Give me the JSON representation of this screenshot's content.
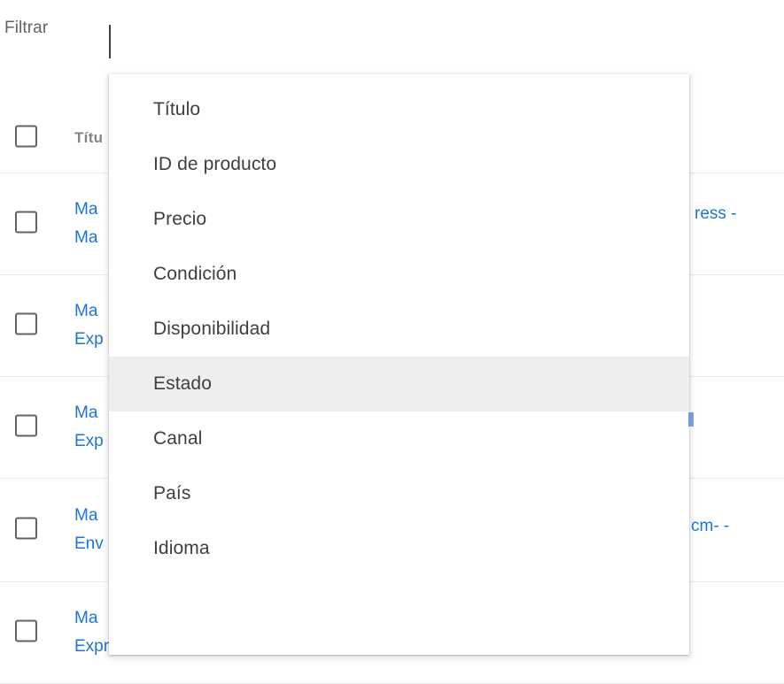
{
  "filter": {
    "label": "Filtrar",
    "input_value": "",
    "placeholder": ""
  },
  "table": {
    "header": {
      "title_column": "Títu"
    },
    "rows": [
      {
        "lines": [
          "Ma",
          "Ma"
        ]
      },
      {
        "lines": [
          "Ma",
          "Exp"
        ]
      },
      {
        "lines": [
          "Ma",
          "Exp"
        ]
      },
      {
        "lines": [
          "Ma",
          "Env"
        ]
      },
      {
        "lines": [
          "Ma",
          "Express - Marsan Piel"
        ]
      }
    ],
    "right_fragments": {
      "row1": "ress -",
      "row4": "cm- -"
    }
  },
  "dropdown": {
    "items": [
      {
        "label": "Título",
        "highlighted": false
      },
      {
        "label": "ID de producto",
        "highlighted": false
      },
      {
        "label": "Precio",
        "highlighted": false
      },
      {
        "label": "Condición",
        "highlighted": false
      },
      {
        "label": "Disponibilidad",
        "highlighted": false
      },
      {
        "label": "Estado",
        "highlighted": true
      },
      {
        "label": "Canal",
        "highlighted": false
      },
      {
        "label": "País",
        "highlighted": false
      },
      {
        "label": "Idioma",
        "highlighted": false
      }
    ]
  },
  "colors": {
    "link": "#1a73e8",
    "header_text": "#80868b",
    "menu_text": "#3c4043",
    "menu_highlight": "#eeeeee",
    "divider": "#e4e6e8"
  }
}
